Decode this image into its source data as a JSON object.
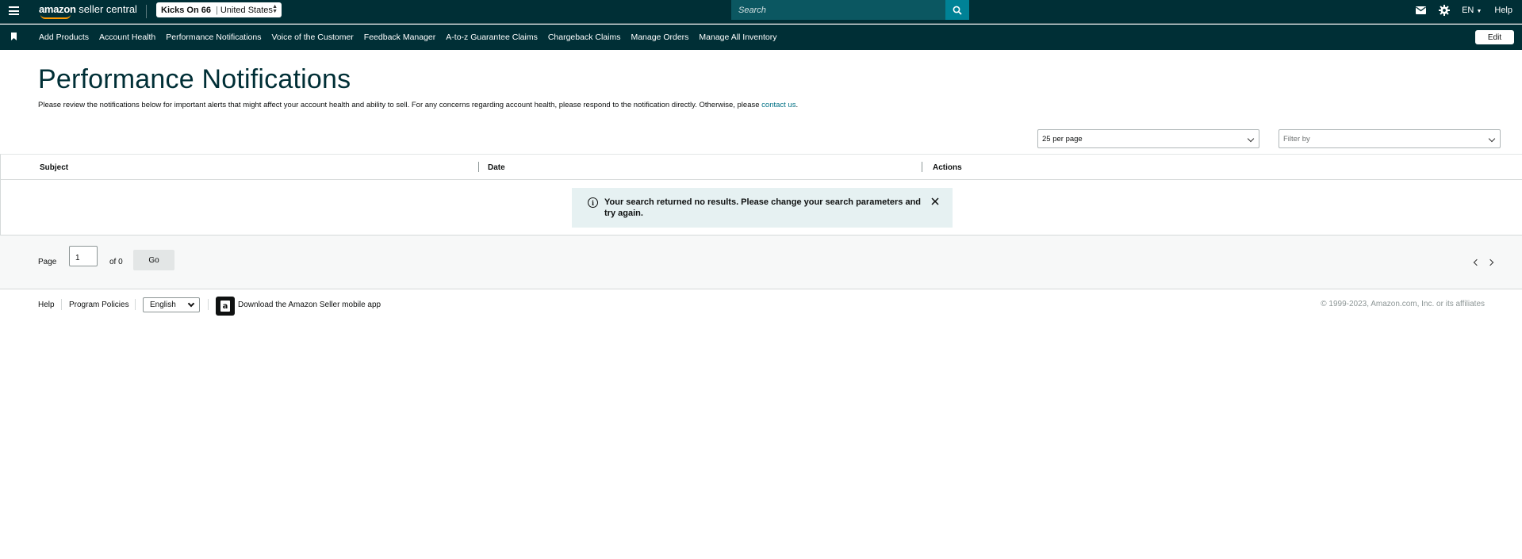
{
  "topbar": {
    "logo_bold": "amazon",
    "logo_text": "seller central",
    "store_name": "Kicks On 66",
    "store_sep": "|",
    "store_region": "United States",
    "search_placeholder": "Search",
    "language": "EN",
    "help": "Help"
  },
  "navbar": {
    "items": [
      "Add Products",
      "Account Health",
      "Performance Notifications",
      "Voice of the Customer",
      "Feedback Manager",
      "A-to-z Guarantee Claims",
      "Chargeback Claims",
      "Manage Orders",
      "Manage All Inventory"
    ],
    "edit_label": "Edit"
  },
  "main": {
    "title": "Performance Notifications",
    "description": "Please review the notifications below for important alerts that might affect your account health and ability to sell. For any concerns regarding account health, please respond to the notification directly. Otherwise, please ",
    "contact_link": "contact us",
    "description_end": ".",
    "per_page": "25 per page",
    "filter_placeholder": "Filter by"
  },
  "table": {
    "columns": [
      "Subject",
      "Date",
      "Actions"
    ],
    "alert": "Your search returned no results. Please change your search parameters and try again."
  },
  "pager": {
    "page_label": "Page",
    "page_value": "1",
    "of_label": "of 0",
    "go_label": "Go"
  },
  "footer": {
    "help": "Help",
    "policies": "Program Policies",
    "language": "English",
    "app_text": "Download the Amazon Seller mobile app",
    "copyright": "© 1999-2023, Amazon.com, Inc. or its affiliates"
  },
  "colors": {
    "header_bg": "#002f36",
    "search_btn": "#008296",
    "link": "#007185",
    "alert_bg": "#e6f1f2"
  }
}
